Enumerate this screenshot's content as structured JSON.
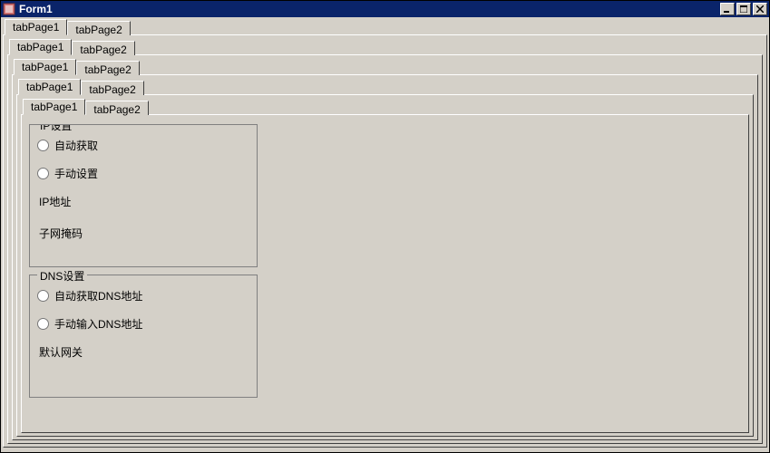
{
  "window": {
    "title": "Form1"
  },
  "tabs": {
    "tab1_label": "tabPage1",
    "tab2_label": "tabPage2"
  },
  "ip_group": {
    "legend": "IP设置",
    "auto_label": "自动获取",
    "manual_label": "手动设置",
    "ip_addr_label": "IP地址",
    "subnet_label": "子网掩码"
  },
  "dns_group": {
    "legend": "DNS设置",
    "auto_label": "自动获取DNS地址",
    "manual_label": "手动输入DNS地址",
    "gateway_label": "默认网关"
  }
}
